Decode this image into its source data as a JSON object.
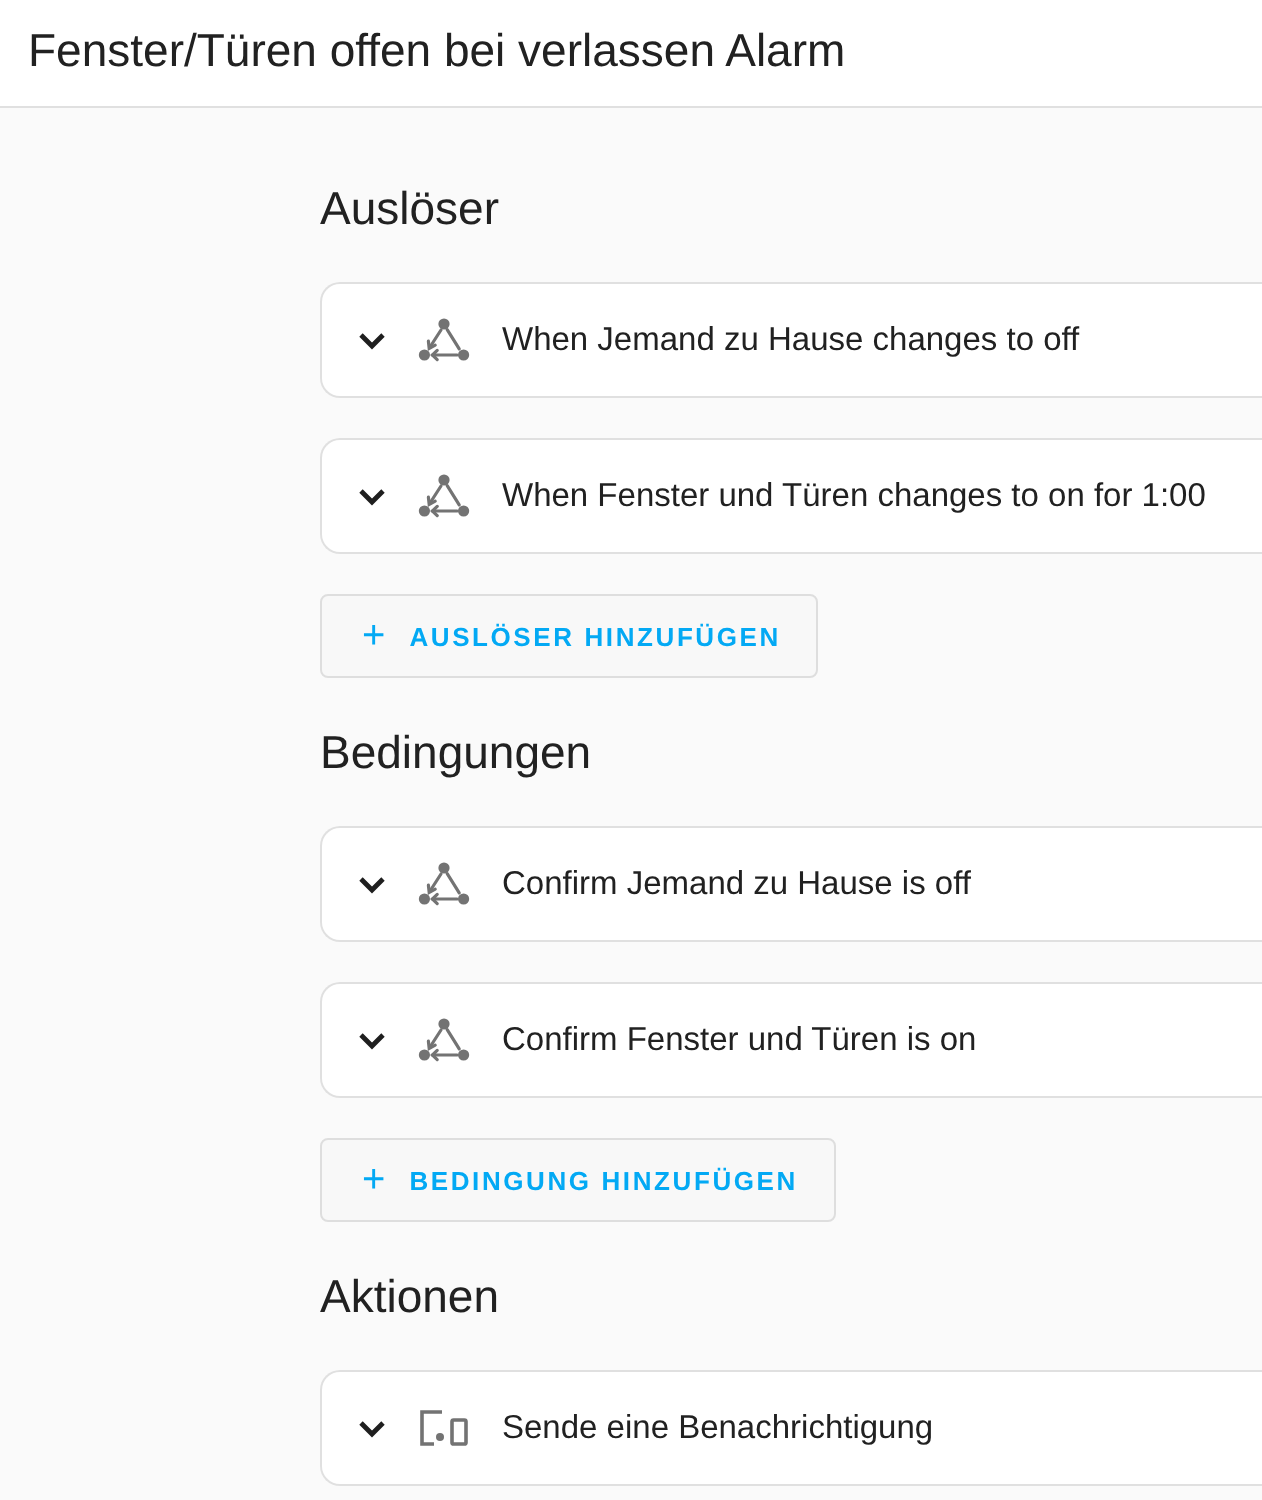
{
  "header": {
    "title": "Fenster/Türen offen bei verlassen Alarm"
  },
  "sections": [
    {
      "heading": "Auslöser",
      "items": [
        {
          "kind": "state",
          "label": "When Jemand zu Hause changes to off",
          "expanded": false
        },
        {
          "kind": "state",
          "label": "When Fenster und Türen changes to on for 1:00",
          "expanded": false
        }
      ],
      "add_button": {
        "icon": "+",
        "label": "AUSLÖSER HINZUFÜGEN"
      }
    },
    {
      "heading": "Bedingungen",
      "items": [
        {
          "kind": "state",
          "label": "Confirm Jemand zu Hause is off",
          "expanded": false
        },
        {
          "kind": "state",
          "label": "Confirm Fenster und Türen is on",
          "expanded": false
        }
      ],
      "add_button": {
        "icon": "+",
        "label": "BEDINGUNG HINZUFÜGEN"
      }
    },
    {
      "heading": "Aktionen",
      "items": [
        {
          "kind": "device",
          "label": "Sende eine Benachrichtigung",
          "expanded": false
        }
      ]
    }
  ]
}
